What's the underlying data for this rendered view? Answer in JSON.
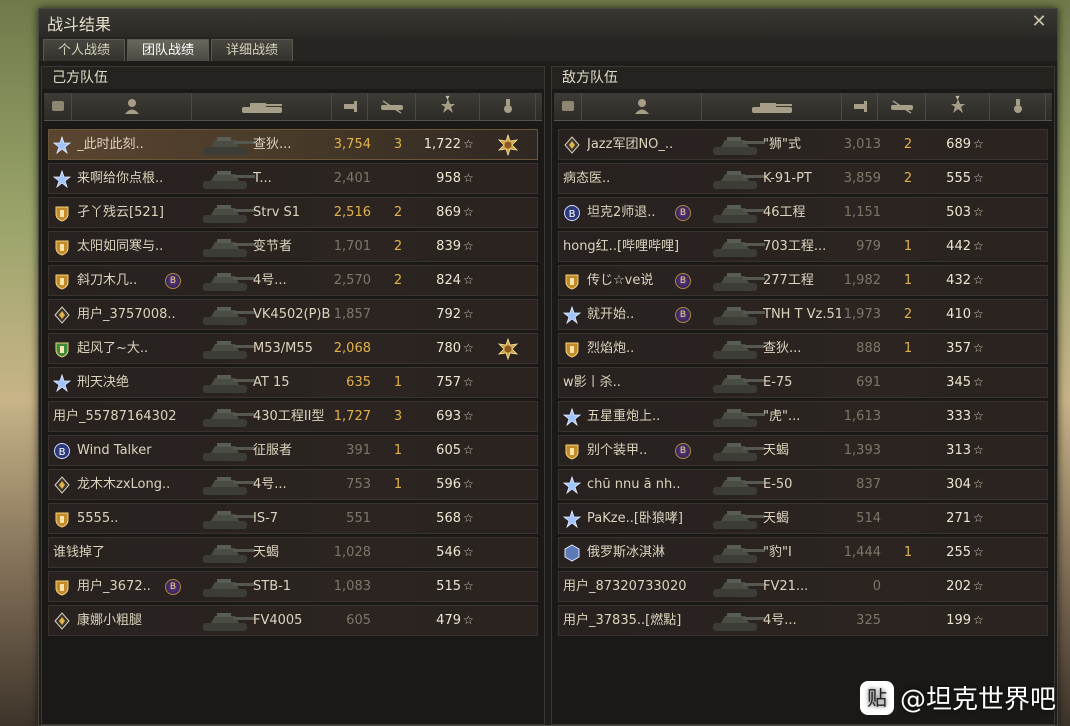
{
  "window": {
    "title": "战斗结果",
    "close_label": "✕"
  },
  "tabs": [
    {
      "label": "个人战绩",
      "active": false
    },
    {
      "label": "团队战绩",
      "active": true
    },
    {
      "label": "详细战绩",
      "active": false
    }
  ],
  "teams": {
    "ally": {
      "title": "己方队伍",
      "rows": [
        {
          "rank": "star",
          "name": "_此时此刻..",
          "clan": false,
          "tank": "查狄...",
          "damage": "3,754",
          "damage_hi": true,
          "kills": "3",
          "xp": "1,722",
          "medal": true,
          "self": true
        },
        {
          "rank": "star",
          "name": "来啊给你点根..",
          "clan": false,
          "tank": "T...",
          "damage": "2,401",
          "damage_hi": false,
          "kills": "",
          "xp": "958",
          "medal": false,
          "self": false
        },
        {
          "rank": "shield",
          "name": "孑丫残云[521]",
          "clan": false,
          "tank": "Strv S1",
          "damage": "2,516",
          "damage_hi": true,
          "kills": "2",
          "xp": "869",
          "medal": false,
          "self": false
        },
        {
          "rank": "shield",
          "name": "太阳如同寒与..",
          "clan": false,
          "tank": "变节者",
          "damage": "1,701",
          "damage_hi": false,
          "kills": "2",
          "xp": "839",
          "medal": false,
          "self": false
        },
        {
          "rank": "shield",
          "name": "斜刀木几..",
          "clan": true,
          "tank": "4号...",
          "damage": "2,570",
          "damage_hi": false,
          "kills": "2",
          "xp": "824",
          "medal": false,
          "self": false
        },
        {
          "rank": "diamond",
          "name": "用户_3757008..",
          "clan": false,
          "tank": "VK4502(P)B",
          "damage": "1,857",
          "damage_hi": false,
          "kills": "",
          "xp": "792",
          "medal": false,
          "self": false
        },
        {
          "rank": "green",
          "name": "起风了~大..",
          "clan": false,
          "tank": "M53/M55",
          "damage": "2,068",
          "damage_hi": true,
          "kills": "",
          "xp": "780",
          "medal": true,
          "self": false
        },
        {
          "rank": "star",
          "name": "刑天决绝",
          "clan": false,
          "tank": "AT 15",
          "damage": "635",
          "damage_hi": true,
          "kills": "1",
          "xp": "757",
          "medal": false,
          "self": false
        },
        {
          "rank": "none",
          "name": "用户_55787164302",
          "clan": false,
          "tank": "430工程II型",
          "damage": "1,727",
          "damage_hi": true,
          "kills": "3",
          "xp": "693",
          "medal": false,
          "self": false
        },
        {
          "rank": "b",
          "name": "Wind Talker",
          "clan": false,
          "tank": "征服者",
          "damage": "391",
          "damage_hi": false,
          "kills": "1",
          "xp": "605",
          "medal": false,
          "self": false
        },
        {
          "rank": "diamond",
          "name": "龙木木zxLong..",
          "clan": false,
          "tank": "4号...",
          "damage": "753",
          "damage_hi": false,
          "kills": "1",
          "xp": "596",
          "medal": false,
          "self": false
        },
        {
          "rank": "shield",
          "name": "5555..",
          "clan": false,
          "tank": "IS-7",
          "damage": "551",
          "damage_hi": false,
          "kills": "",
          "xp": "568",
          "medal": false,
          "self": false
        },
        {
          "rank": "none",
          "name": "谁钱掉了",
          "clan": false,
          "tank": "天蝎",
          "damage": "1,028",
          "damage_hi": false,
          "kills": "",
          "xp": "546",
          "medal": false,
          "self": false
        },
        {
          "rank": "shield",
          "name": "用户_3672..",
          "clan": true,
          "tank": "STB-1",
          "damage": "1,083",
          "damage_hi": false,
          "kills": "",
          "xp": "515",
          "medal": false,
          "self": false
        },
        {
          "rank": "diamond",
          "name": "康娜小粗腿",
          "clan": false,
          "tank": "FV4005",
          "damage": "605",
          "damage_hi": false,
          "kills": "",
          "xp": "479",
          "medal": false,
          "self": false
        }
      ]
    },
    "enemy": {
      "title": "敌方队伍",
      "rows": [
        {
          "rank": "diamond",
          "name": "Jazz军团NO_..",
          "clan": false,
          "tank": "\"狮\"式",
          "damage": "3,013",
          "damage_hi": false,
          "kills": "2",
          "xp": "689"
        },
        {
          "rank": "none",
          "name": "病态医..",
          "clan": false,
          "tank": "K-91-PT",
          "damage": "3,859",
          "damage_hi": false,
          "kills": "2",
          "xp": "555"
        },
        {
          "rank": "b",
          "name": "坦克2师退..",
          "clan": true,
          "tank": "46工程",
          "damage": "1,151",
          "damage_hi": false,
          "kills": "",
          "xp": "503"
        },
        {
          "rank": "none",
          "name": "hong红..[哔哩哔哩]",
          "clan": false,
          "tank": "703工程...",
          "damage": "979",
          "damage_hi": false,
          "kills": "1",
          "xp": "442"
        },
        {
          "rank": "shield",
          "name": "传じ☆ve说",
          "clan": true,
          "tank": "277工程",
          "damage": "1,982",
          "damage_hi": false,
          "kills": "1",
          "xp": "432"
        },
        {
          "rank": "star",
          "name": "就开始..",
          "clan": true,
          "tank": "TNH T Vz.51",
          "damage": "1,973",
          "damage_hi": false,
          "kills": "2",
          "xp": "410"
        },
        {
          "rank": "shield",
          "name": "烈焰炮..",
          "clan": false,
          "tank": "查狄...",
          "damage": "888",
          "damage_hi": false,
          "kills": "1",
          "xp": "357"
        },
        {
          "rank": "none",
          "name": "w影丨杀..",
          "clan": false,
          "tank": "E-75",
          "damage": "691",
          "damage_hi": false,
          "kills": "",
          "xp": "345"
        },
        {
          "rank": "star",
          "name": "五星重炮上..",
          "clan": false,
          "tank": "\"虎\"...",
          "damage": "1,613",
          "damage_hi": false,
          "kills": "",
          "xp": "333"
        },
        {
          "rank": "shield",
          "name": "别个装甲..",
          "clan": true,
          "tank": "天蝎",
          "damage": "1,393",
          "damage_hi": false,
          "kills": "",
          "xp": "313"
        },
        {
          "rank": "star",
          "name": "chū nnu ā nh..",
          "clan": false,
          "tank": "E-50",
          "damage": "837",
          "damage_hi": false,
          "kills": "",
          "xp": "304"
        },
        {
          "rank": "star",
          "name": "PaKze..[卧狼哮]",
          "clan": false,
          "tank": "天蝎",
          "damage": "514",
          "damage_hi": false,
          "kills": "",
          "xp": "271"
        },
        {
          "rank": "cube",
          "name": "俄罗斯冰淇淋",
          "clan": false,
          "tank": "\"豹\"I",
          "damage": "1,444",
          "damage_hi": false,
          "kills": "1",
          "xp": "255"
        },
        {
          "rank": "none",
          "name": "用户_87320733020",
          "clan": false,
          "tank": "FV21...",
          "damage": "0",
          "damage_hi": false,
          "kills": "",
          "xp": "202"
        },
        {
          "rank": "none",
          "name": "用户_37835..[燃點]",
          "clan": false,
          "tank": "4号...",
          "damage": "325",
          "damage_hi": false,
          "kills": "",
          "xp": "199"
        }
      ]
    }
  },
  "icons": {
    "xp_star": "☆",
    "clan_badge": "B"
  },
  "watermark": {
    "logo": "贴",
    "text": "@坦克世界吧"
  },
  "colors": {
    "accent": "#e2b24a",
    "text": "#dcd3bd",
    "dim": "#7d7668"
  }
}
